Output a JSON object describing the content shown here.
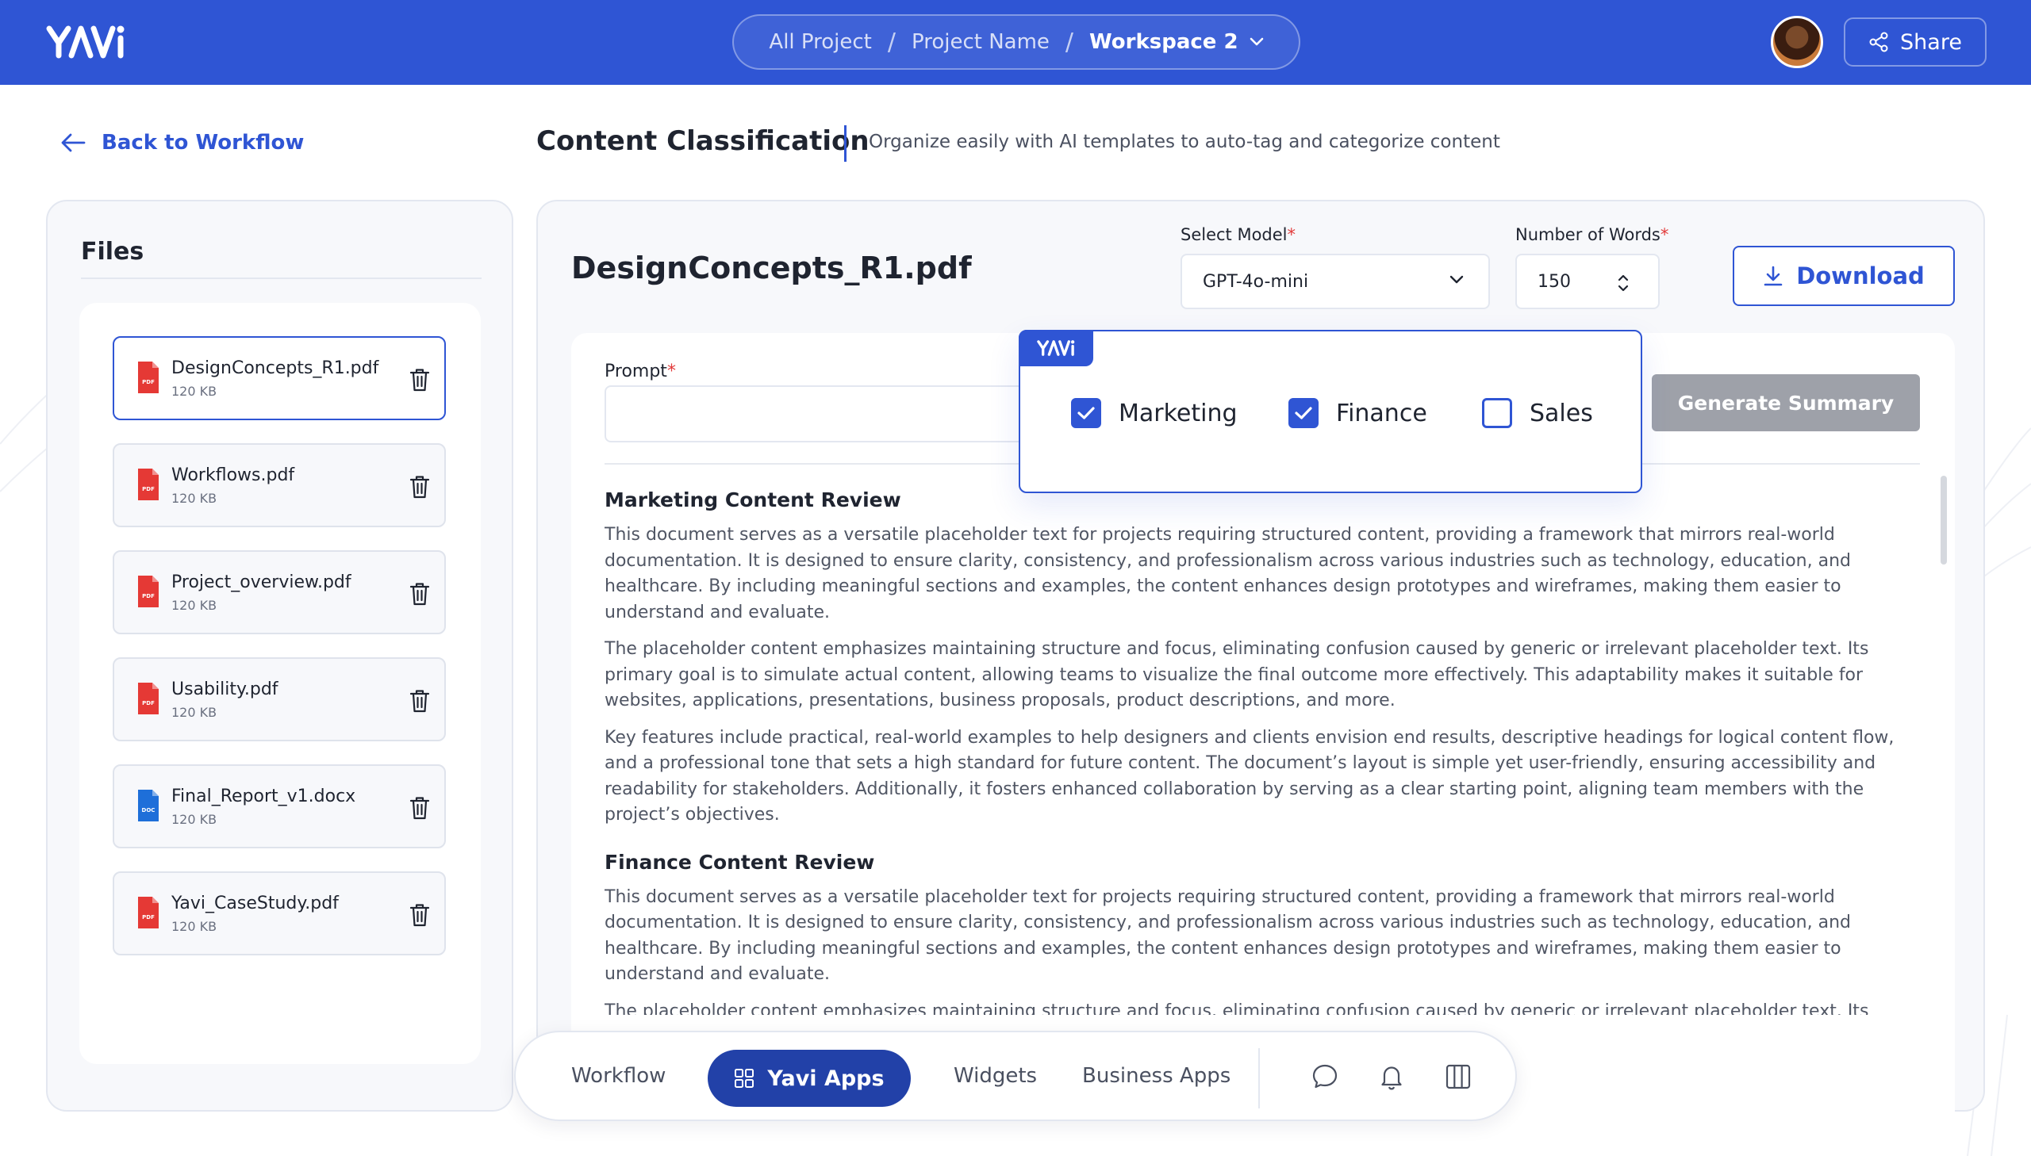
{
  "header": {
    "logo_text": "YAVI",
    "breadcrumb": [
      {
        "label": "All Project"
      },
      {
        "label": "Project Name"
      },
      {
        "label": "Workspace 2"
      }
    ],
    "share_label": "Share"
  },
  "nav": {
    "back_label": "Back to Workflow"
  },
  "page": {
    "title": "Content Classification",
    "subtitle": "Organize easily with AI templates to auto-tag and categorize content"
  },
  "files": {
    "title": "Files",
    "items": [
      {
        "name": "DesignConcepts_R1.pdf",
        "size": "120 KB",
        "type": "pdf",
        "type_label": "PDF",
        "selected": true
      },
      {
        "name": "Workflows.pdf",
        "size": "120 KB",
        "type": "pdf",
        "type_label": "PDF",
        "selected": false
      },
      {
        "name": "Project_overview.pdf",
        "size": "120 KB",
        "type": "pdf",
        "type_label": "PDF",
        "selected": false
      },
      {
        "name": "Usability.pdf",
        "size": "120 KB",
        "type": "pdf",
        "type_label": "PDF",
        "selected": false
      },
      {
        "name": "Final_Report_v1.docx",
        "size": "120 KB",
        "type": "doc",
        "type_label": "DOC",
        "selected": false
      },
      {
        "name": "Yavi_CaseStudy.pdf",
        "size": "120 KB",
        "type": "pdf",
        "type_label": "PDF",
        "selected": false
      }
    ]
  },
  "document": {
    "title": "DesignConcepts_R1.pdf",
    "select_model_label": "Select Model",
    "select_model_value": "GPT-4o-mini",
    "num_words_label": "Number of Words",
    "num_words_value": "150",
    "download_label": "Download",
    "prompt_label": "Prompt",
    "prompt_value": "",
    "generate_label": "Generate Summary",
    "required_mark": "*"
  },
  "classification": {
    "tag_text": "YAVI",
    "categories": [
      {
        "label": "Marketing",
        "checked": true
      },
      {
        "label": "Finance",
        "checked": true
      },
      {
        "label": "Sales",
        "checked": false
      }
    ]
  },
  "content": {
    "sections": [
      {
        "heading": "Marketing Content Review",
        "paragraphs": [
          "This document serves as a versatile placeholder text for projects requiring structured content, providing a framework that mirrors real-world documentation. It is designed to ensure clarity, consistency, and professionalism across various industries such as technology, education, and healthcare. By including meaningful sections and examples, the content enhances design prototypes and wireframes, making them easier to understand and evaluate.",
          "The placeholder content emphasizes maintaining structure and focus, eliminating confusion caused by generic or irrelevant placeholder text. Its primary goal is to simulate actual content, allowing teams to visualize the final outcome more effectively. This adaptability makes it suitable for websites, applications, presentations, business proposals, product descriptions, and more.",
          "Key features include practical, real-world examples to help designers and clients envision end results, descriptive headings for logical content flow, and a professional tone that sets a high standard for future content. The document’s layout is simple yet user-friendly, ensuring accessibility and readability for stakeholders. Additionally, it fosters enhanced collaboration by serving as a clear starting point, aligning team members with the project’s objectives."
        ]
      },
      {
        "heading": "Finance Content Review",
        "paragraphs": [
          "This document serves as a versatile placeholder text for projects requiring structured content, providing a framework that mirrors real-world documentation. It is designed to ensure clarity, consistency, and professionalism across various industries such as technology, education, and healthcare. By including meaningful sections and examples, the content enhances design prototypes and wireframes, making them easier to understand and evaluate.",
          "The placeholder content emphasizes maintaining structure and focus, eliminating confusion caused by generic or irrelevant placeholder text. Its primary"
        ]
      }
    ]
  },
  "bottom_nav": {
    "items": [
      {
        "label": "Workflow"
      },
      {
        "label": "Yavi Apps",
        "active": true
      },
      {
        "label": "Widgets"
      },
      {
        "label": "Business Apps"
      }
    ],
    "icons": [
      "chat-icon",
      "bell-icon",
      "columns-icon"
    ]
  },
  "colors": {
    "brand": "#2f55d4",
    "brand_dark": "#2241a8",
    "pdf_red": "#e53935",
    "doc_blue": "#1e6fd9",
    "required": "#e23b3b"
  }
}
